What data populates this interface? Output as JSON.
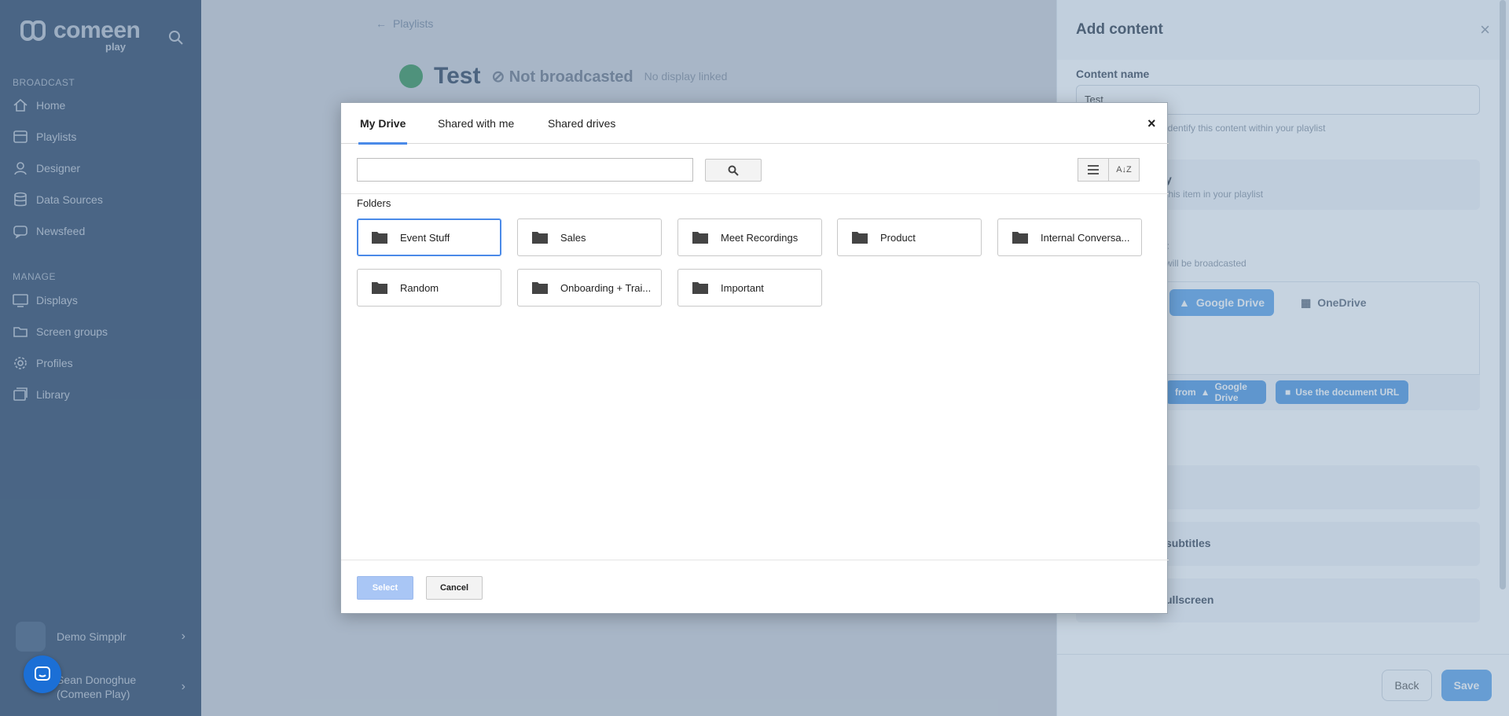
{
  "sidebar": {
    "logo": "comeen",
    "logo_sub": "play",
    "sections": {
      "broadcast": "BROADCAST",
      "manage": "MANAGE"
    },
    "broadcast_items": [
      {
        "label": "Home",
        "icon": "home-icon"
      },
      {
        "label": "Playlists",
        "icon": "playlist-icon"
      },
      {
        "label": "Designer",
        "icon": "designer-icon"
      },
      {
        "label": "Data Sources",
        "icon": "database-icon"
      },
      {
        "label": "Newsfeed",
        "icon": "newsfeed-icon"
      }
    ],
    "manage_items": [
      {
        "label": "Displays",
        "icon": "display-icon"
      },
      {
        "label": "Screen groups",
        "icon": "folder-icon"
      },
      {
        "label": "Profiles",
        "icon": "gear-icon"
      },
      {
        "label": "Library",
        "icon": "library-icon"
      }
    ],
    "org_name": "Demo Simpplr",
    "user_name_line1": "Sean Donoghue",
    "user_name_line2": "(Comeen Play)"
  },
  "main": {
    "breadcrumb": "Playlists",
    "title": "Test",
    "status": "Not broadcasted",
    "display_status": "No display linked"
  },
  "panel": {
    "title": "Add content",
    "content_name_label": "Content name",
    "content_name_value": "Test",
    "content_name_help": "identify this content within your playlist",
    "card1_title": "y",
    "card1_text": "this item in your playlist",
    "card2_title": ":",
    "card2_text": "will be broadcasted",
    "source_tabs": [
      "Google Drive",
      "OneDrive"
    ],
    "pill_from": "from",
    "pill_gdrive": "Google Drive",
    "pill_url": "Use the document URL",
    "option_subtitles": "subtitles",
    "option_fullscreen": "ullscreen",
    "back_label": "Back",
    "save_label": "Save"
  },
  "picker": {
    "tabs": [
      "My Drive",
      "Shared with me",
      "Shared drives"
    ],
    "active_tab": "My Drive",
    "search_value": "",
    "folders_label": "Folders",
    "folders": [
      "Event Stuff",
      "Sales",
      "Meet Recordings",
      "Product",
      "Internal Conversa...",
      "Random",
      "Onboarding + Trai...",
      "Important"
    ],
    "selected_folder": "Event Stuff",
    "select_label": "Select",
    "cancel_label": "Cancel",
    "close_glyph": "×"
  },
  "colors": {
    "sidebar_bg": "#2f4c6e",
    "accent_blue": "#4a8ae8",
    "save_blue": "#5ca2e8",
    "select_disabled": "#a9c6f5"
  }
}
